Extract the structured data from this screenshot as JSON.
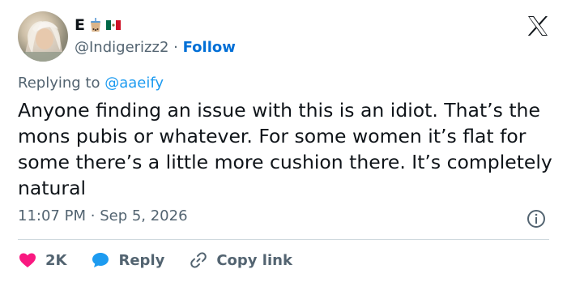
{
  "user": {
    "display_name": "E",
    "handle": "@Indigerizz2",
    "separator": "·",
    "follow_label": "Follow"
  },
  "reply": {
    "prefix": "Replying to",
    "mention": "@aaeify"
  },
  "tweet": {
    "text": "Anyone finding an issue with this is an idiot. That’s the mons pubis or whatever. For some women it’s flat for some there’s a little more cushion there. It’s completely natural",
    "time": "11:07 PM",
    "separator": "·",
    "date": "Sep 5, 2026"
  },
  "actions": {
    "like_count": "2K",
    "reply_label": "Reply",
    "copy_label": "Copy link"
  },
  "colors": {
    "like": "#f91880",
    "reply": "#1d9bf0",
    "link": "#006fd6",
    "muted": "#536471"
  },
  "icons": [
    "x-logo-icon",
    "bubble-tea-icon",
    "mexico-flag-icon",
    "info-icon",
    "heart-icon",
    "reply-bubble-icon",
    "link-icon"
  ]
}
